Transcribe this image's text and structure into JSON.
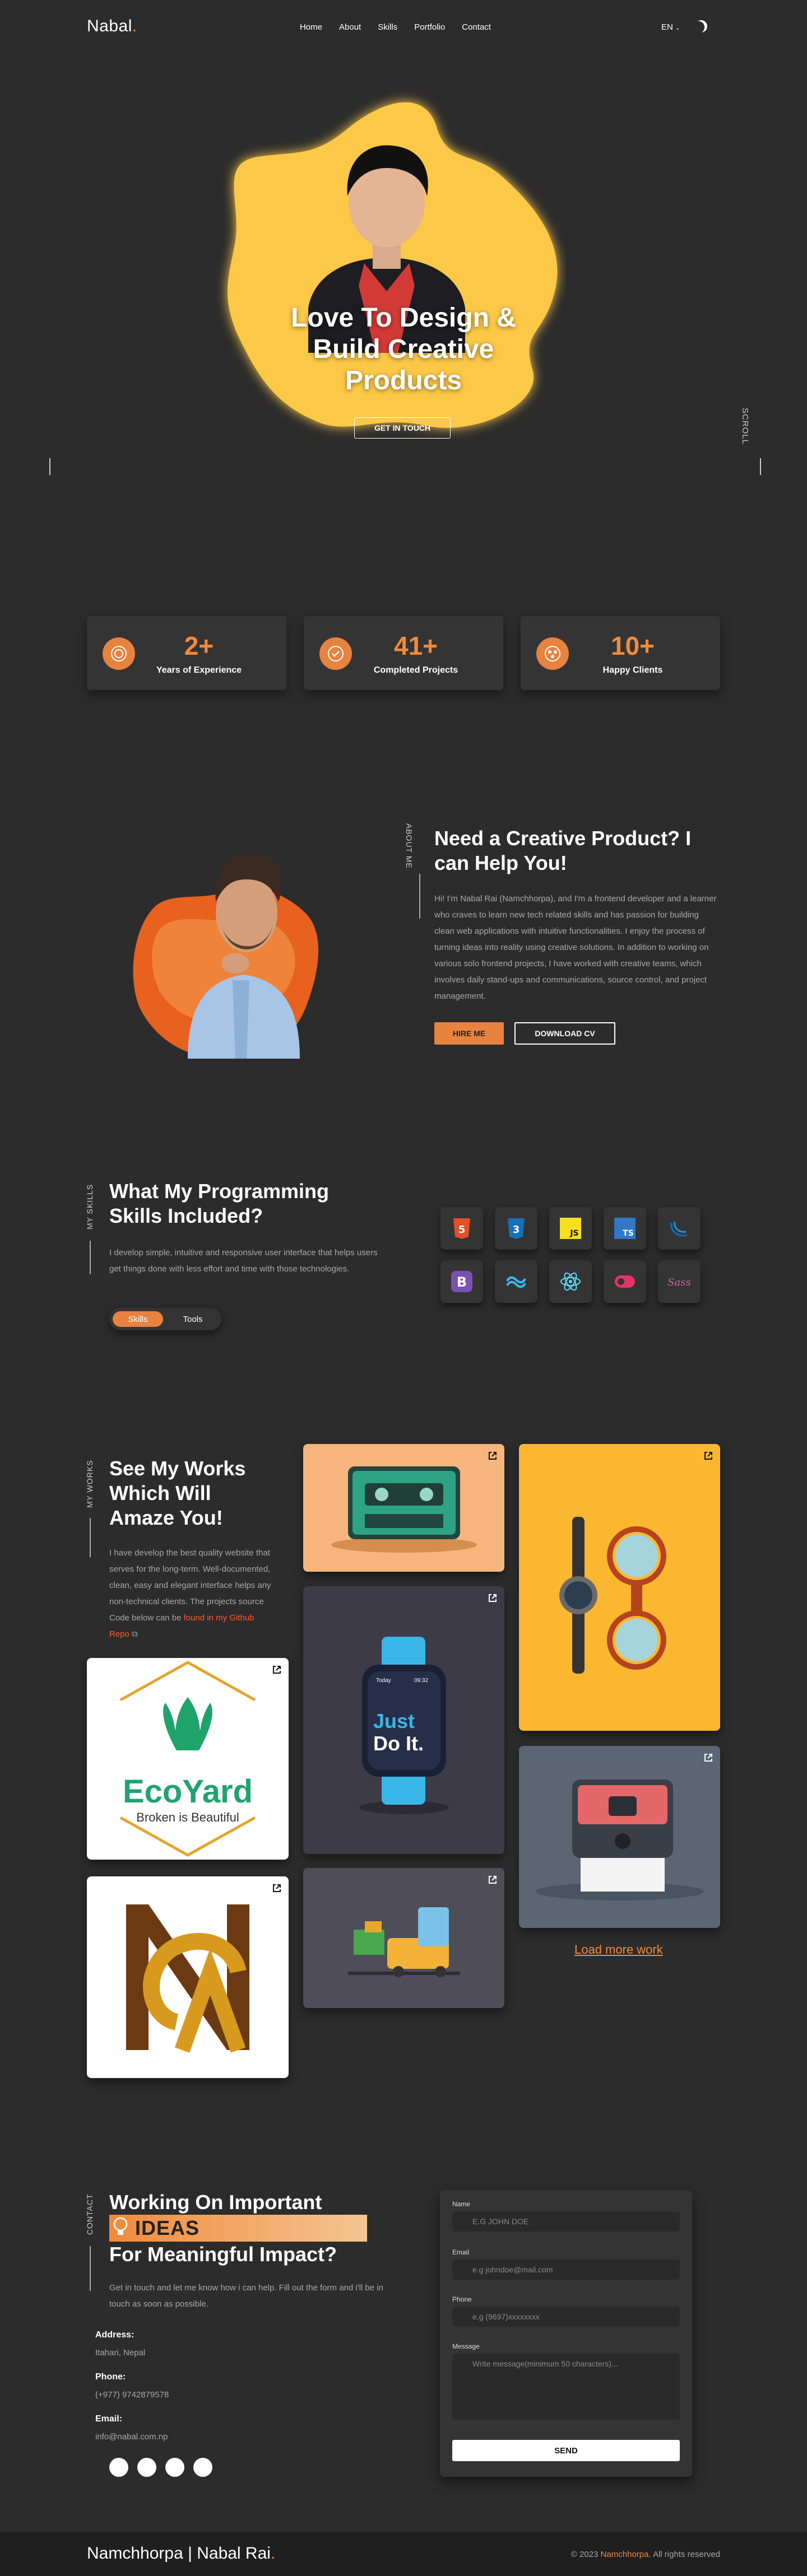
{
  "nav": {
    "logo": "Nabal",
    "logo_dot": ".",
    "items": [
      "Home",
      "About",
      "Skills",
      "Portfolio",
      "Contact"
    ],
    "lang": "EN",
    "theme_icon": "moon-icon"
  },
  "hero": {
    "title": "Love To Design & Build Creative Products",
    "button": "GET IN TOUCH",
    "scroll": "SCROLL"
  },
  "stats": [
    {
      "value": "2+",
      "label": "Years of Experience",
      "icon": "medal-icon"
    },
    {
      "value": "41+",
      "label": "Completed Projects",
      "icon": "check-badge-icon"
    },
    {
      "value": "10+",
      "label": "Happy Clients",
      "icon": "clients-icon"
    }
  ],
  "about": {
    "vertical": "ABOUT ME",
    "title": "Need a Creative Product? I can Help You!",
    "body": "Hi! I'm Nabal Rai (Namchhorpa), and I'm a frontend developer and a learner who craves to learn new tech related skills and has passion for building clean web applications with intuitive functionalities. I enjoy the process of turning ideas into reality using creative solutions. In addition to working on various solo frontend projects, I have worked with creative teams, which involves daily stand-ups and communications, source control, and project management.",
    "hire": "HIRE ME",
    "cv": "DOWNLOAD CV"
  },
  "skills": {
    "vertical": "MY SKILLS",
    "title": "What My Programming Skills Included?",
    "body": "I develop simple, intuitive and responsive user interface that helps users get things done with less effort and time with those technologies.",
    "toggle_on": "Skills",
    "toggle_off": "Tools",
    "icons": [
      "html5-icon",
      "css3-icon",
      "javascript-icon",
      "typescript-icon",
      "jquery-icon",
      "bootstrap-icon",
      "tailwind-icon",
      "react-icon",
      "redux-icon",
      "sass-icon"
    ]
  },
  "works": {
    "vertical": "MY WORKS",
    "title": "See My Works Which Will Amaze You!",
    "body": "I have develop the best quality website that serves for the long-term. Well-documented, clean, easy and elegant interface helps any non-technical clients. The projects source Code below can be",
    "link": "found in my Github Repo",
    "load_more": "Load more work",
    "ecoyard_name": "EcoYard",
    "ecoyard_tag": "Broken is Beautiful",
    "watch_text1": "Just",
    "watch_text2": "Do It.",
    "watch_time": "Today",
    "watch_clock": "09:32"
  },
  "contact": {
    "vertical": "CONTACT",
    "title_line1": "Working On Important",
    "ideas": "IDEAS",
    "title_line3": "For Meaningful Impact?",
    "sub": "Get in touch and let me know how i can help. Fill out the form and i'll be in touch as soon as possible.",
    "address_h": "Address:",
    "address_v": "Itahari, Nepal",
    "phone_h": "Phone:",
    "phone_v": "(+977) 9742879578",
    "email_h": "Email:",
    "email_v": "info@nabal.com.np",
    "form": {
      "name_l": "Name",
      "name_p": "E.G JOHN DOE",
      "email_l": "Email",
      "email_p": "e.g johndoe@mail.com",
      "phone_l": "Phone",
      "phone_p": "e.g (9697)xxxxxxxx",
      "message_l": "Message",
      "message_p": "Write message(minimum 50 characters)...",
      "send": "SEND"
    }
  },
  "footer": {
    "name": "Namchhorpa | Nabal Rai",
    "dot": ".",
    "copy_pre": "© 2023",
    "copy_hl": "Namchhorpa.",
    "copy_post": "All rights reserved"
  }
}
